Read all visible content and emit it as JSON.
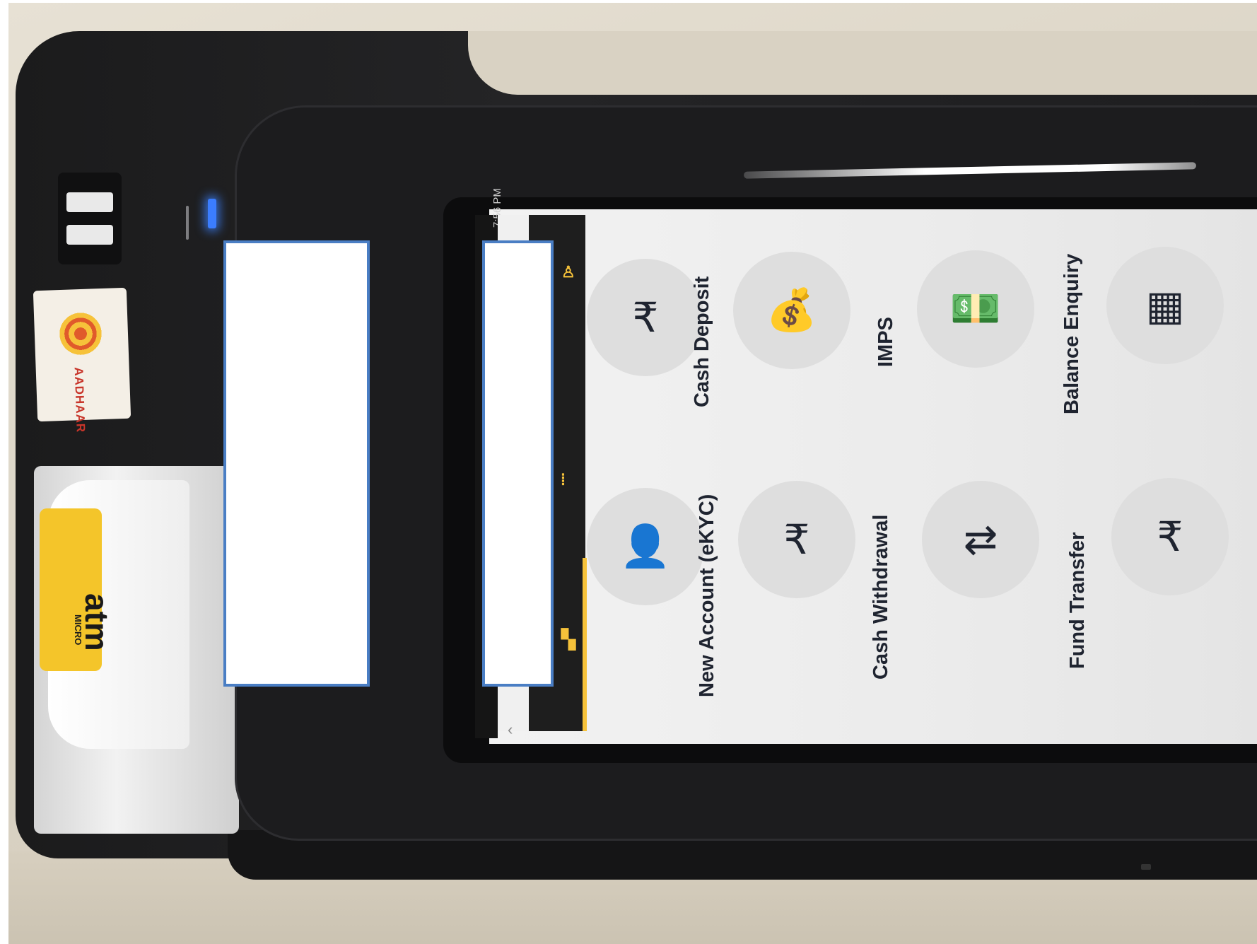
{
  "status_bar": {
    "time": "7:56 PM"
  },
  "device": {
    "sticker_aadhaar": "AADHAAR",
    "sticker_matm": "atm",
    "sticker_matm_small": "MICRO"
  },
  "services": [
    {
      "id": "new-account",
      "label": "New Account (eKYC)",
      "icon": "person-add-icon"
    },
    {
      "id": "cash-deposit",
      "label": "Cash Deposit",
      "icon": "cash-deposit-icon"
    },
    {
      "id": "cash-withdrawal",
      "label": "Cash Withdrawal",
      "icon": "cash-withdrawal-icon"
    },
    {
      "id": "imps",
      "label": "IMPS",
      "icon": "money-bag-icon"
    },
    {
      "id": "fund-transfer",
      "label": "Fund Transfer",
      "icon": "fund-transfer-icon"
    },
    {
      "id": "balance-enquiry",
      "label": "Balance Enquiry",
      "icon": "balance-enquiry-icon"
    }
  ],
  "colors": {
    "accent": "#f6c23a",
    "redaction_border": "#4a7ec4",
    "led": "#3b7dff",
    "icon_dark": "#1f2430",
    "icon_blue": "#2f7fc1"
  }
}
